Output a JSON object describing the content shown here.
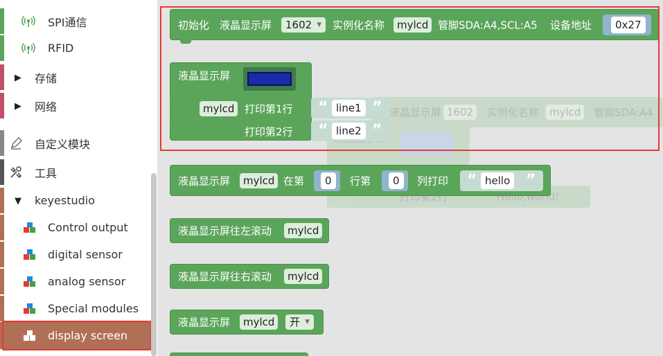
{
  "sidebar": {
    "items": [
      {
        "label": "SPI通信",
        "icon": "wireless-icon",
        "color": "#5ba55b"
      },
      {
        "label": "RFID",
        "icon": "wireless-icon",
        "color": "#5ba55b"
      },
      {
        "label": "存储",
        "icon": "triangle-right-icon",
        "color": "#c0506a"
      },
      {
        "label": "网络",
        "icon": "triangle-right-icon",
        "color": "#c0506a"
      },
      {
        "label": "自定义模块",
        "icon": "pencil-icon",
        "color": "#888888"
      },
      {
        "label": "工具",
        "icon": "tools-icon",
        "color": "#555555"
      },
      {
        "label": "keyestudio",
        "icon": "triangle-down-icon",
        "color": "#b07055"
      },
      {
        "label": "Control output",
        "icon": "blocks-icon",
        "color": "#b07055"
      },
      {
        "label": "digital sensor",
        "icon": "blocks-icon",
        "color": "#b07055"
      },
      {
        "label": "analog sensor",
        "icon": "blocks-icon",
        "color": "#b07055"
      },
      {
        "label": "Special modules",
        "icon": "blocks-icon",
        "color": "#b07055"
      },
      {
        "label": "display screen",
        "icon": "blocks-icon",
        "color": "#b07055",
        "selected": true
      }
    ]
  },
  "blocks": {
    "init": {
      "label": "初始化",
      "lcd_label": "液晶显示屏",
      "model": "1602",
      "inst_label": "实例化名称",
      "inst_name": "mylcd",
      "pins": "管脚SDA:A4,SCL:A5",
      "addr_label": "设备地址",
      "addr": "0x27"
    },
    "print2": {
      "label": "液晶显示屏",
      "name": "mylcd",
      "line1_label": "打印第1行",
      "line1": "line1",
      "line2_label": "打印第2行",
      "line2": "line2"
    },
    "printpos": {
      "label": "液晶显示屏",
      "name": "mylcd",
      "at": "在第",
      "row": "0",
      "row_label": "行第",
      "col": "0",
      "col_label": "列打印",
      "text": "hello"
    },
    "scroll_left": {
      "label": "液晶显示屏往左滚动",
      "name": "mylcd"
    },
    "scroll_right": {
      "label": "液晶显示屏往右滚动",
      "name": "mylcd"
    },
    "power": {
      "label": "液晶显示屏",
      "name": "mylcd",
      "state": "开"
    }
  },
  "ghost": {
    "init_lcd": "液晶显示屏",
    "init_model": "1602",
    "init_inst": "实例化名称",
    "init_name": "mylcd",
    "init_pins": "管脚SDA:A4",
    "lcd_label": "液晶显示屏",
    "line2_label": "打印第2行",
    "line2_text": "Hello,world!"
  }
}
